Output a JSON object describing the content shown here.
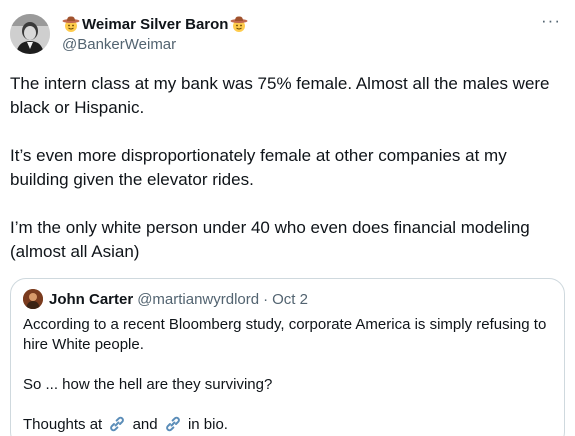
{
  "author": {
    "emoji_left": "cowboy-hat-face-emoji",
    "name": "Weimar Silver Baron",
    "emoji_right": "cowboy-hat-face-emoji",
    "handle": "@BankerWeimar"
  },
  "more_label": "···",
  "body": {
    "paragraphs": [
      "The intern class at my bank was 75% female. Almost all the males were black or Hispanic.",
      "It’s even more disproportionately female at other companies at my building given the elevator rides.",
      "I’m the only white person under 40 who even does financial modeling (almost all Asian)"
    ]
  },
  "quote": {
    "name": "John Carter",
    "handle": "@martianwyrdlord",
    "separator": "·",
    "date": "Oct 2",
    "line1": "According to a recent Bloomberg study, corporate America is simply refusing to hire White people.",
    "line2": "So ... how the hell are they surviving?",
    "line3_start": "Thoughts at",
    "line3_mid": "and",
    "line3_end": "in bio."
  },
  "colors": {
    "text": "#0f1419",
    "secondary": "#536471",
    "border": "#cfd9de",
    "link_icon": "#5b8db8"
  }
}
